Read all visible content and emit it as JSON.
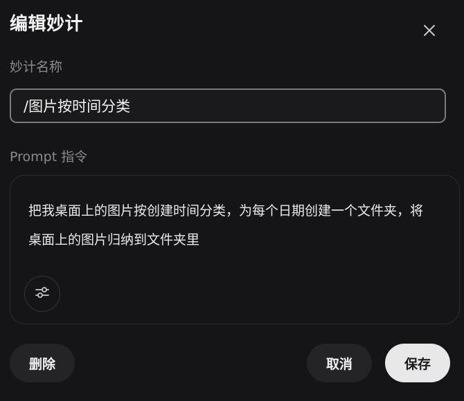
{
  "dialog": {
    "title": "编辑妙计",
    "close_icon": "close-icon"
  },
  "name_field": {
    "label": "妙计名称",
    "value": "/图片按时间分类"
  },
  "prompt_field": {
    "label": "Prompt 指令",
    "text": "把我桌面上的图片按创建时间分类，为每个日期创建一个文件夹，将桌面上的图片归纳到文件夹里",
    "settings_icon": "sliders-icon"
  },
  "buttons": {
    "delete": "删除",
    "cancel": "取消",
    "save": "保存"
  },
  "colors": {
    "background": "#151517",
    "input_border": "#7a7a7e",
    "secondary_button": "#242427",
    "primary_button": "#e8e8e8",
    "label_text": "#8b8b8f"
  }
}
